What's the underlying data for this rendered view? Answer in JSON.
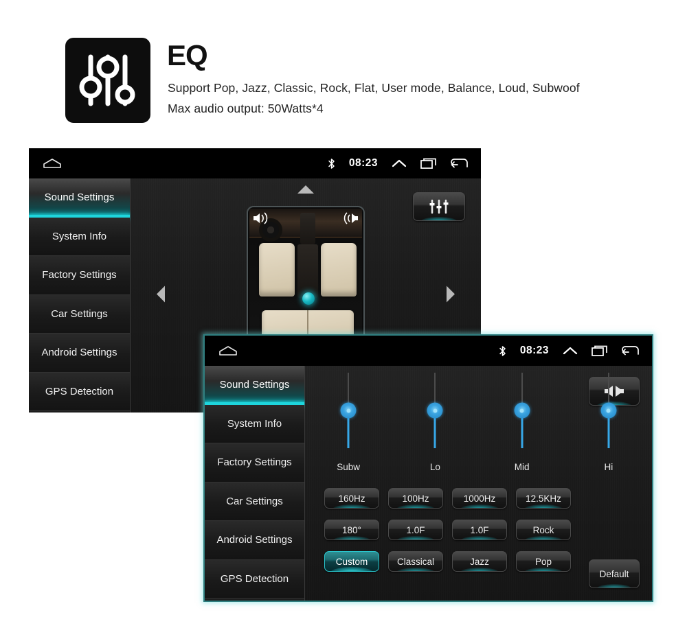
{
  "header": {
    "title": "EQ",
    "icon": "equalizer-sliders-icon",
    "line1": "Support Pop, Jazz, Classic, Rock, Flat, User mode, Balance, Loud, Subwoof",
    "line2": "Max audio output: 50Watts*4"
  },
  "colors": {
    "accent_teal": "#1ed6dd",
    "slider_blue": "#37a8e8",
    "panel_bg": "#1a1a1a",
    "icon_bg": "#0d0d0d"
  },
  "statusbar": {
    "home_icon": "home-icon",
    "bluetooth_icon": "bluetooth-icon",
    "time": "08:23",
    "expand_icon": "chevron-up-icon",
    "recents_icon": "recent-apps-icon",
    "back_icon": "back-arrow-icon"
  },
  "sidebar": {
    "items": [
      {
        "label": "Sound Settings",
        "active": true
      },
      {
        "label": "System Info",
        "active": false
      },
      {
        "label": "Factory Settings",
        "active": false
      },
      {
        "label": "Car Settings",
        "active": false
      },
      {
        "label": "Android Settings",
        "active": false
      },
      {
        "label": "GPS Detection",
        "active": false
      }
    ]
  },
  "panel1": {
    "screen_name": "Sound Settings - Balance / Fader",
    "eq_button_icon": "equalizer-icon",
    "up_arrow_icon": "fader-up-arrow-icon",
    "left_arrow_icon": "balance-left-arrow-icon",
    "right_arrow_icon": "balance-right-arrow-icon",
    "car_image": "car-interior-topview",
    "speaker_front_left_icon": "speaker-icon",
    "speaker_front_right_icon": "speaker-icon",
    "position_dot": "balance-position-dot"
  },
  "panel2": {
    "screen_name": "Sound Settings - Equalizer",
    "balance_button_icon": "balance-speakers-icon",
    "default_button_label": "Default",
    "sliders": [
      {
        "label": "Subw",
        "value": 50
      },
      {
        "label": "Lo",
        "value": 50
      },
      {
        "label": "Mid",
        "value": 50
      },
      {
        "label": "Hi",
        "value": 50
      }
    ],
    "buttons": [
      {
        "label": "160Hz",
        "selected": false
      },
      {
        "label": "100Hz",
        "selected": false
      },
      {
        "label": "1000Hz",
        "selected": false
      },
      {
        "label": "12.5KHz",
        "selected": false
      },
      {
        "label": "180°",
        "selected": false
      },
      {
        "label": "1.0F",
        "selected": false
      },
      {
        "label": "1.0F",
        "selected": false
      },
      {
        "label": "Rock",
        "selected": false
      },
      {
        "label": "Custom",
        "selected": true
      },
      {
        "label": "Classical",
        "selected": false
      },
      {
        "label": "Jazz",
        "selected": false
      },
      {
        "label": "Pop",
        "selected": false
      }
    ]
  }
}
